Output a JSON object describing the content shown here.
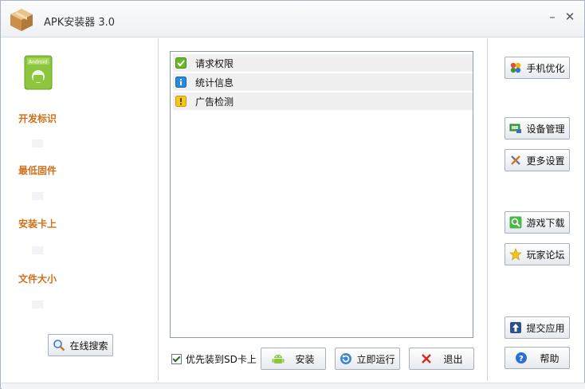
{
  "window": {
    "title": "APK安装器 3.0"
  },
  "left_panel": {
    "labels": [
      "开发标识",
      "最低固件",
      "安装卡上",
      "文件大小"
    ],
    "search_button": "在线搜索"
  },
  "checklist": {
    "items": [
      {
        "label": "请求权限",
        "icon": "green-check-icon"
      },
      {
        "label": "统计信息",
        "icon": "blue-info-icon"
      },
      {
        "label": "广告检测",
        "icon": "yellow-warning-icon"
      }
    ]
  },
  "bottom": {
    "sd_checkbox_label": "优先装到SD卡上",
    "sd_checked": true,
    "install_button": "安装",
    "run_button": "立即运行",
    "exit_button": "退出"
  },
  "right_panel": {
    "optimize": "手机优化",
    "device_manage": "设备管理",
    "more_settings": "更多设置",
    "game_download": "游戏下载",
    "player_forum": "玩家论坛",
    "submit_app": "提交应用",
    "help": "帮助"
  },
  "colors": {
    "label_orange": "#d0701a",
    "list_item_bg": "#f0f0f0",
    "border": "#a7b0bc"
  }
}
